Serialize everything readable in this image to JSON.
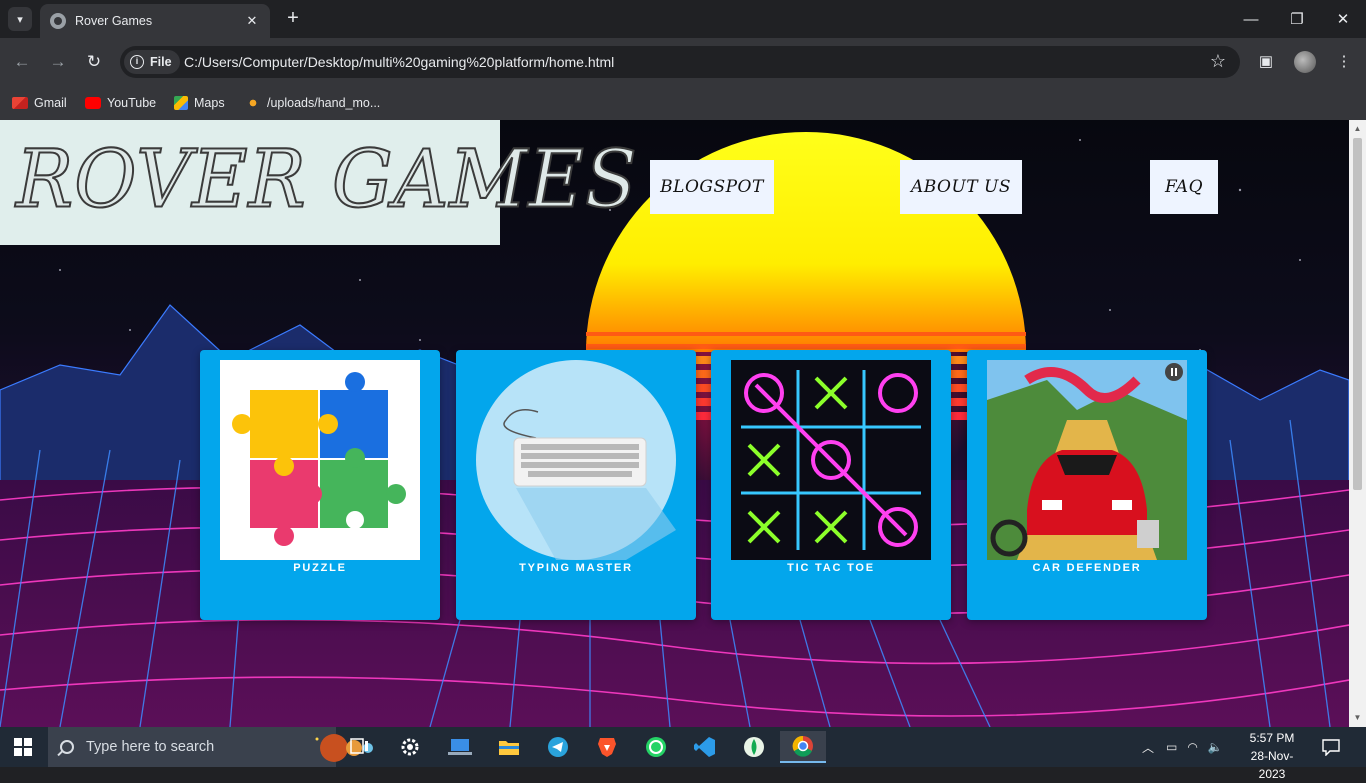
{
  "browser": {
    "tab_title": "Rover Games",
    "address_chip": "File",
    "url": "C:/Users/Computer/Desktop/multi%20gaming%20platform/home.html",
    "bookmarks": [
      {
        "label": "Gmail",
        "icon": "gmail-icon"
      },
      {
        "label": "YouTube",
        "icon": "youtube-icon"
      },
      {
        "label": "Maps",
        "icon": "maps-icon"
      },
      {
        "label": "/uploads/hand_mo...",
        "icon": "uploads-icon"
      }
    ]
  },
  "site": {
    "logo": "ROVER GAMES",
    "nav": [
      "BLOGSPOT",
      "ABOUT US",
      "FAQ"
    ],
    "games": [
      {
        "name": "PUZZLE",
        "thumb": "puzzle-pieces"
      },
      {
        "name": "TYPING MASTER",
        "thumb": "keyboard"
      },
      {
        "name": "TIC TAC TOE",
        "thumb": "neon-tic-tac-toe-board"
      },
      {
        "name": "CAR DEFENDER",
        "thumb": "red-sports-car"
      }
    ],
    "colors": {
      "card": "#03a6ec",
      "sun": "#ffff00",
      "grid": "#ff3cc8"
    }
  },
  "taskbar": {
    "search_placeholder": "Type here to search",
    "time": "5:57 PM",
    "date": "28-Nov-2023"
  }
}
